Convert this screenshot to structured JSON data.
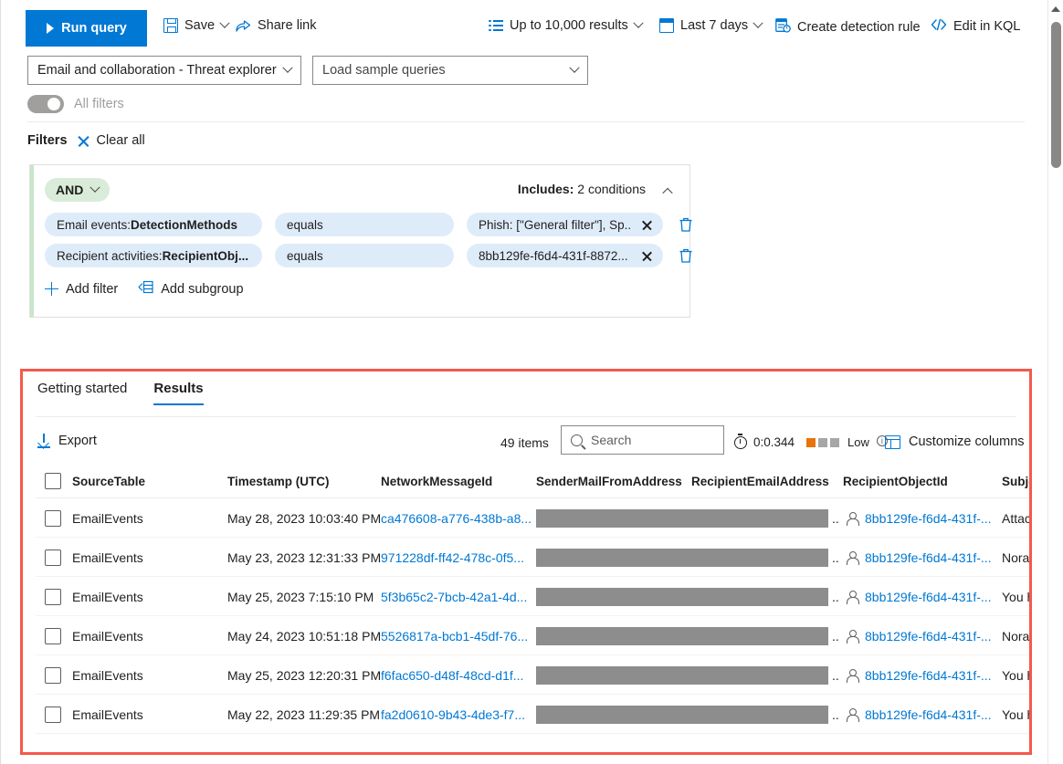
{
  "toolbar": {
    "run_query": "Run query",
    "save": "Save",
    "share_link": "Share link",
    "results_limit": "Up to 10,000 results",
    "time_range": "Last 7 days",
    "create_detection_rule": "Create detection rule",
    "edit_in_kql": "Edit in KQL"
  },
  "query_selectors": {
    "scope_value": "Email and collaboration - Threat explorer",
    "sample_queries_placeholder": "Load sample queries"
  },
  "all_filters_toggle": {
    "label": "All filters",
    "state": "off"
  },
  "filters": {
    "title": "Filters",
    "clear_all": "Clear all",
    "group": {
      "operator": "AND",
      "includes_label": "Includes:",
      "includes_value": "2 conditions",
      "conditions": [
        {
          "field_prefix": "Email events: ",
          "field_name": "DetectionMethods",
          "operator": "equals",
          "value": "Phish: [\"General filter\"], Sp..."
        },
        {
          "field_prefix": "Recipient activities: ",
          "field_name": "RecipientObj...",
          "operator": "equals",
          "value": "8bb129fe-f6d4-431f-8872..."
        }
      ],
      "add_filter": "Add filter",
      "add_subgroup": "Add subgroup"
    }
  },
  "results_panel": {
    "tabs": [
      {
        "label": "Getting started",
        "active": false
      },
      {
        "label": "Results",
        "active": true
      }
    ],
    "export_label": "Export",
    "items_count": "49 items",
    "search_placeholder": "Search",
    "query_duration": "0:0.344",
    "resource_usage": "Low",
    "customize_columns": "Customize columns",
    "highlight_color": "#f4594c",
    "accent_color": "#0078d4",
    "usage_bar_color": "#e8730a",
    "usage_bar_empty_color": "#a6a6a6",
    "redaction_color": "#8d8d8d"
  },
  "table": {
    "columns": [
      "SourceTable",
      "Timestamp (UTC)",
      "NetworkMessageId",
      "SenderMailFromAddress",
      "RecipientEmailAddress",
      "RecipientObjectId",
      "Subject"
    ],
    "rows": [
      {
        "source_table": "EmailEvents",
        "timestamp": "May 28, 2023 10:03:40 PM",
        "network_message_id": "ca476608-a776-438b-a8...",
        "sender_mail_from_address": "",
        "recipient_email_address": "..",
        "recipient_object_id": "8bb129fe-f6d4-431f-...",
        "subject": "Attache"
      },
      {
        "source_table": "EmailEvents",
        "timestamp": "May 23, 2023 12:31:33 PM",
        "network_message_id": "971228df-ff42-478c-0f5...",
        "sender_mail_from_address": "",
        "recipient_email_address": "..",
        "recipient_object_id": "8bb129fe-f6d4-431f-...",
        "subject": "Norah"
      },
      {
        "source_table": "EmailEvents",
        "timestamp": "May 25, 2023 7:15:10 PM",
        "network_message_id": "5f3b65c2-7bcb-42a1-4d...",
        "sender_mail_from_address": "",
        "recipient_email_address": "..",
        "recipient_object_id": "8bb129fe-f6d4-431f-...",
        "subject": "You ha"
      },
      {
        "source_table": "EmailEvents",
        "timestamp": "May 24, 2023 10:51:18 PM",
        "network_message_id": "5526817a-bcb1-45df-76...",
        "sender_mail_from_address": "",
        "recipient_email_address": "..",
        "recipient_object_id": "8bb129fe-f6d4-431f-...",
        "subject": "Norah"
      },
      {
        "source_table": "EmailEvents",
        "timestamp": "May 25, 2023 12:20:31 PM",
        "network_message_id": "f6fac650-d48f-48cd-d1f...",
        "sender_mail_from_address": "",
        "recipient_email_address": "..",
        "recipient_object_id": "8bb129fe-f6d4-431f-...",
        "subject": "You ha"
      },
      {
        "source_table": "EmailEvents",
        "timestamp": "May 22, 2023 11:29:35 PM",
        "network_message_id": "fa2d0610-9b43-4de3-f7...",
        "sender_mail_from_address": "",
        "recipient_email_address": "..",
        "recipient_object_id": "8bb129fe-f6d4-431f-...",
        "subject": "You ha"
      }
    ]
  }
}
